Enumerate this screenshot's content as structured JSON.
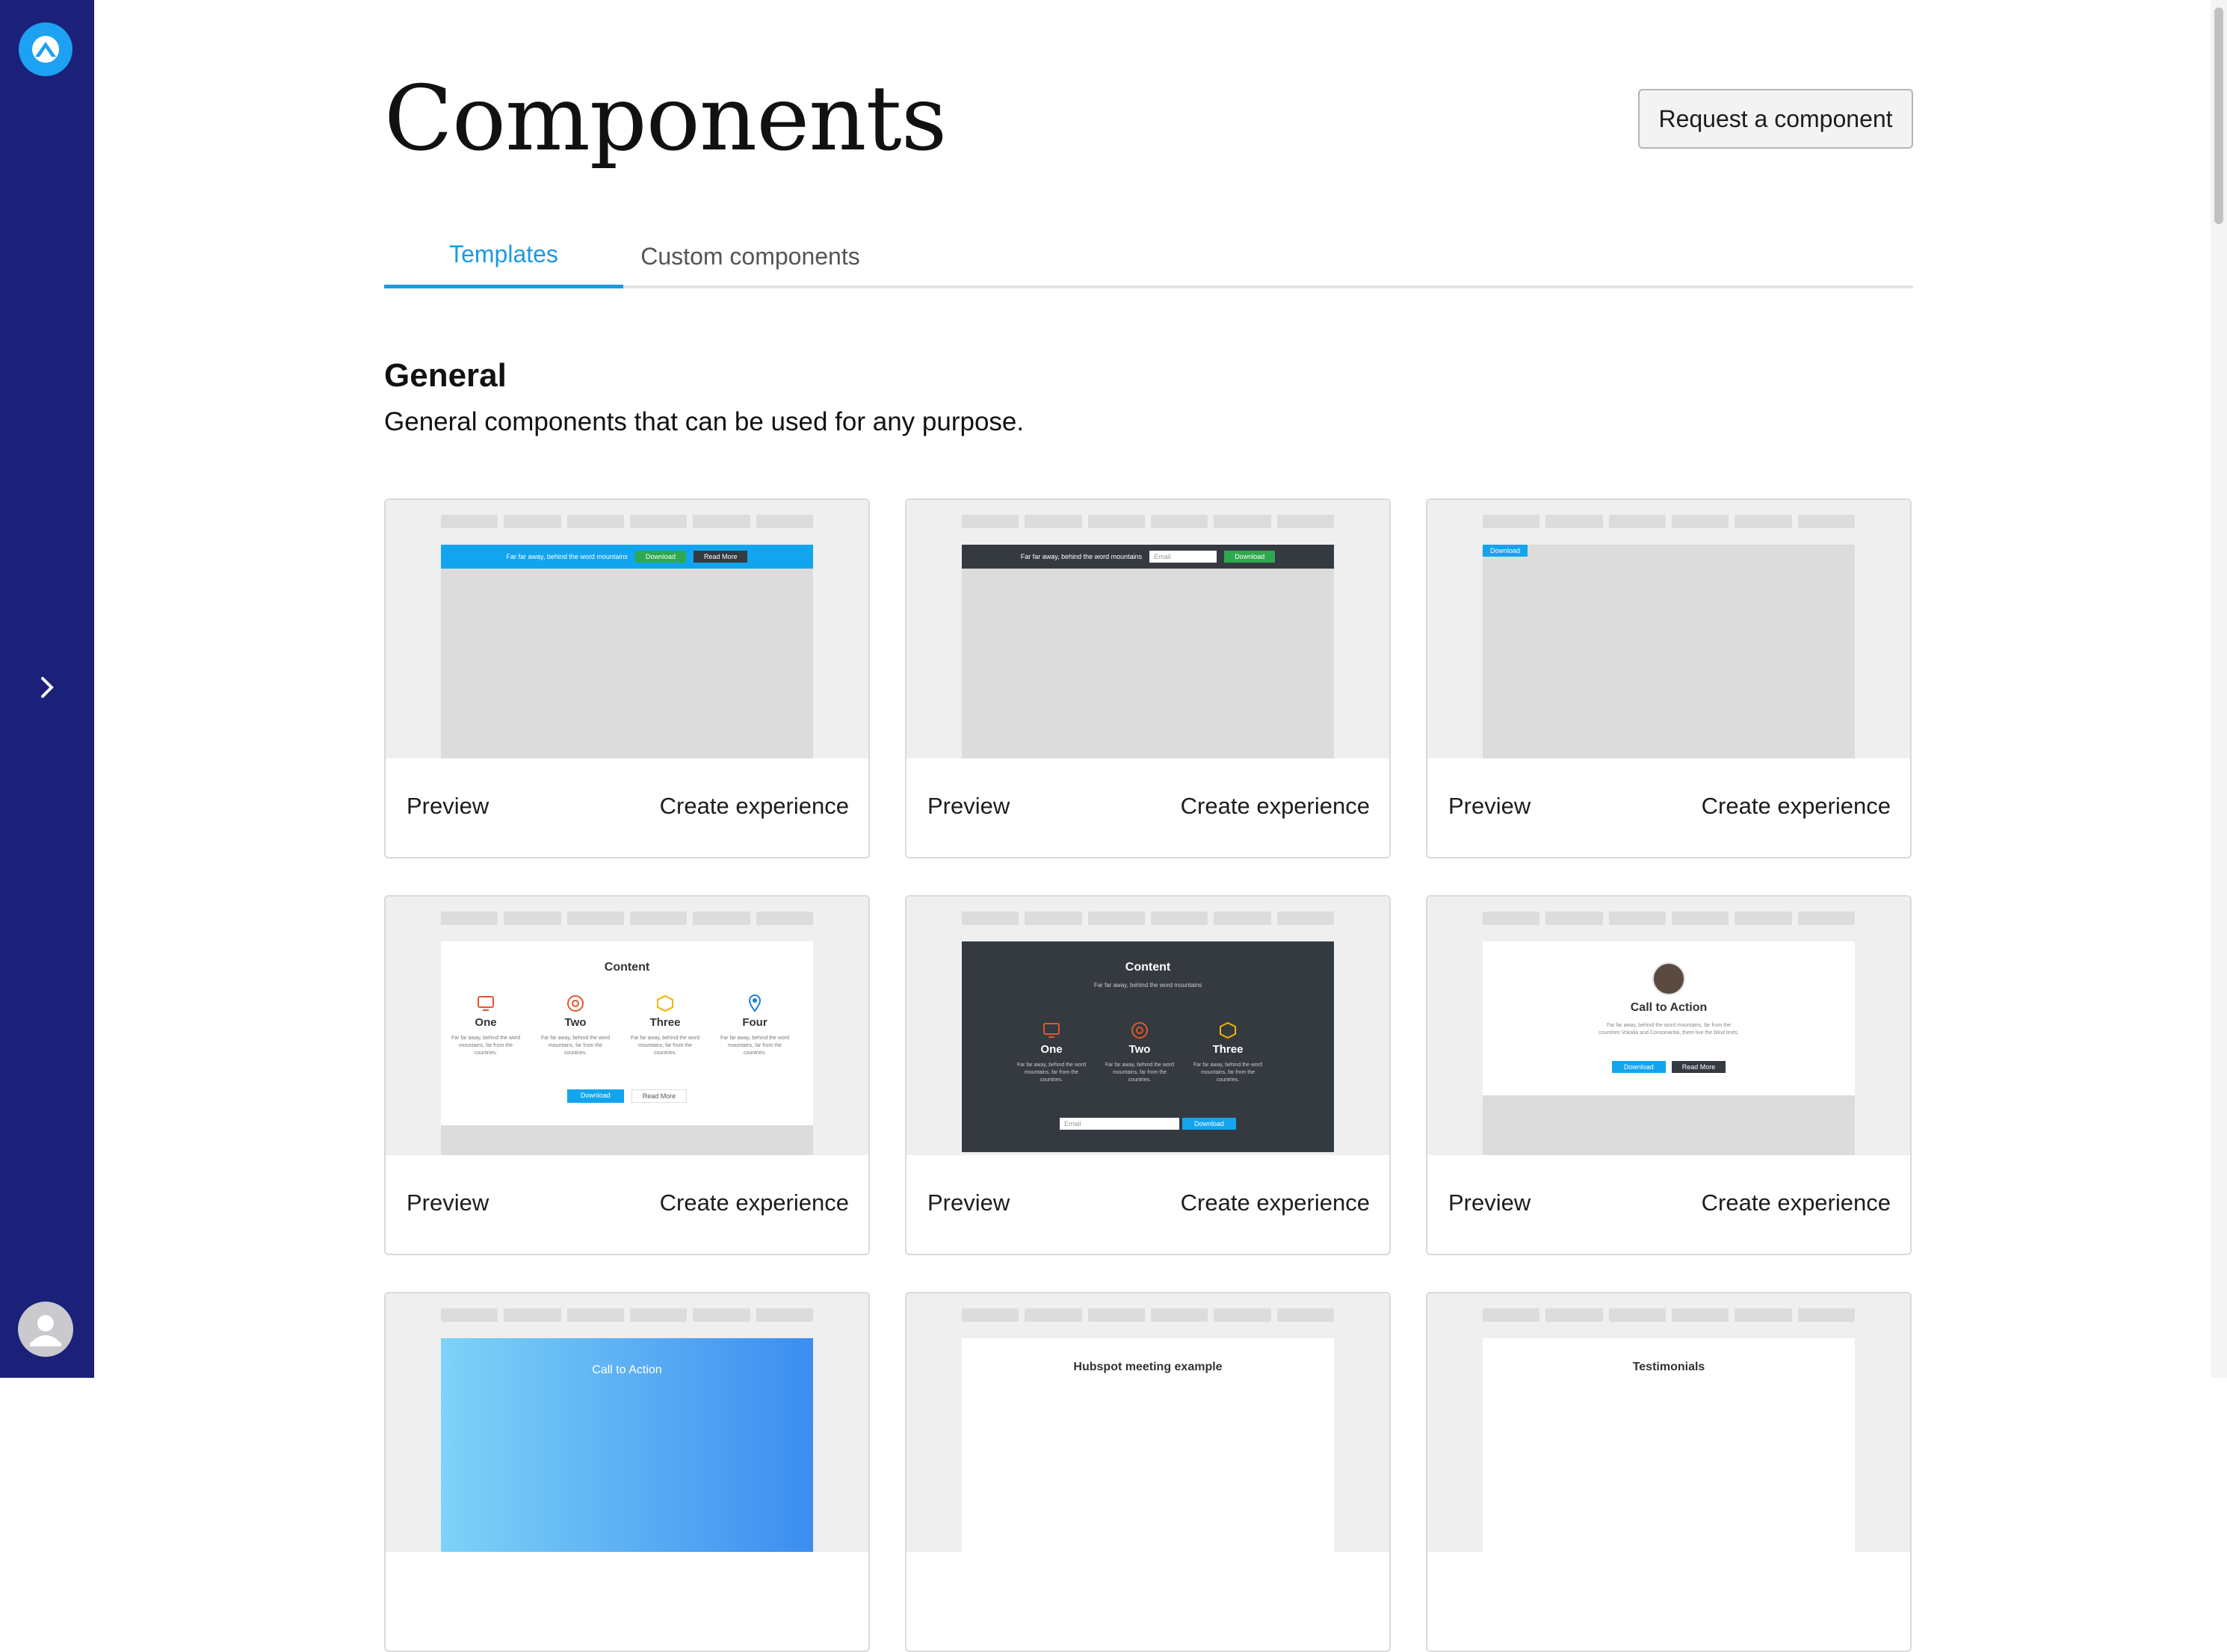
{
  "sidebar": {
    "logo_icon": "app-logo-icon",
    "expand_icon": "chevron-right-icon",
    "user_icon": "user-avatar-icon"
  },
  "colors": {
    "sidebar": "#1b2178",
    "accent": "#1a9ae0",
    "green": "#2fa84f",
    "dark": "#343a40"
  },
  "header": {
    "title": "Components",
    "request_button": "Request a component"
  },
  "tabs": [
    {
      "label": "Templates",
      "active": true
    },
    {
      "label": "Custom components",
      "active": false
    }
  ],
  "section": {
    "title": "General",
    "description": "General components that can be used for any purpose."
  },
  "card_actions": {
    "preview": "Preview",
    "create": "Create experience"
  },
  "previews": {
    "banner_text": "Far far away, behind the word mountains",
    "download": "Download",
    "read_more": "Read More",
    "email": "Email",
    "content_title": "Content",
    "content_sub": "Far far away, behind the word mountains",
    "col_text": "Far far away, behind the word mountains, far from the countries.",
    "cols": [
      "One",
      "Two",
      "Three",
      "Four"
    ],
    "cta_title": "Call to Action",
    "cta_text": "Far far away, behind the word mountains, far from the countries Vokalia and Consonantia, there live the blind texts.",
    "hubspot": "Hubspot meeting example",
    "testimonials": "Testimonials"
  }
}
